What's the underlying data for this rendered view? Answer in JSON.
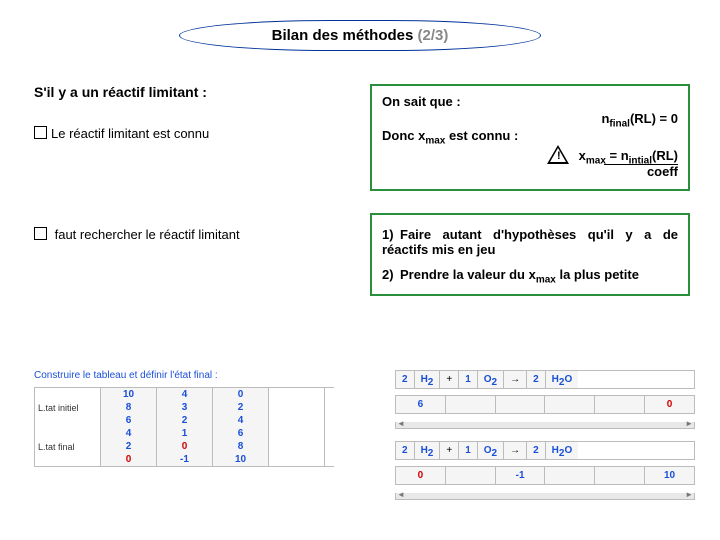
{
  "title": {
    "main": "Bilan des méthodes ",
    "page": "(2/3)"
  },
  "left": {
    "heading": "S'il y a un réactif limitant :",
    "b1_pre": "Le réactif limitant est connu",
    "b2_pre": " faut rechercher le réactif limitant"
  },
  "right": {
    "l1": "On sait que :",
    "eq1_a": "n",
    "eq1_sub": "final",
    "eq1_b": "(RL) = 0",
    "l2a": "Donc x",
    "l2sub": "max",
    "l2b": " est connu :",
    "eq2_a": "x",
    "eq2_as": "max",
    "eq2_b": " = n",
    "eq2_bs": "intial",
    "eq2_c": "(RL)",
    "eq2_den": "coeff",
    "ol1": "Faire autant d'hypothèses qu'il y a de réactifs mis en jeu",
    "ol2": "Prendre la valeur du x",
    "ol2sub": "max",
    "ol2b": " la plus petite"
  },
  "btm_left": {
    "caption": "Construire le tableau et définir l'état final :",
    "row_a": "L.tat initiel",
    "row_b": "L.tat final",
    "c1": [
      "10",
      "8",
      "6",
      "4",
      "2",
      "0"
    ],
    "c2": [
      "4",
      "3",
      "2",
      "1",
      "0",
      "-1"
    ],
    "c3": [
      "0",
      "2",
      "4",
      "6",
      "8",
      "10"
    ]
  },
  "btm_right": {
    "eq": [
      {
        "c": "2",
        "s": "H",
        "sub": "2"
      },
      {
        "op": "+"
      },
      {
        "c": "1",
        "s": "O",
        "sub": "2"
      },
      {
        "op": "→"
      },
      {
        "c": "2",
        "s": "H",
        "sub": "2",
        "tail": "O"
      }
    ],
    "row1": [
      "6",
      "",
      "",
      "",
      "",
      "0"
    ],
    "row2_eq": [
      {
        "c": "2",
        "s": "H",
        "sub": "2"
      },
      {
        "op": "+"
      },
      {
        "c": "1",
        "s": "O",
        "sub": "2"
      },
      {
        "op": "→"
      },
      {
        "c": "2",
        "s": "H",
        "sub": "2",
        "tail": "O"
      }
    ],
    "row2": [
      "0",
      "",
      "-1",
      "",
      "",
      "10"
    ]
  }
}
